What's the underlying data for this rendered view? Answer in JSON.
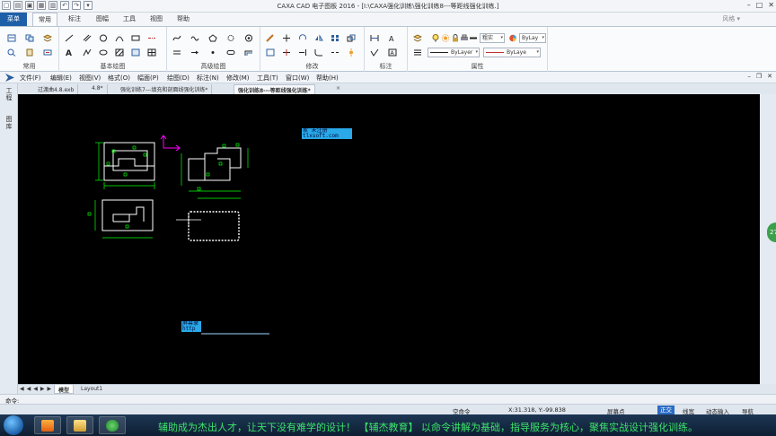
{
  "window": {
    "title": "CAXA CAD 电子图板 2016 - [I:\\CAXA强化训练\\强化训练8---等距线强化训练.]",
    "quick_access_icons": [
      "new-file-icon",
      "open-folder-icon",
      "save-icon",
      "save-as-icon",
      "print-icon",
      "undo-icon",
      "redo-icon",
      "dropdown-icon"
    ]
  },
  "ribbon_tabs": {
    "menu_button": "菜单",
    "tabs": [
      "常用",
      "标注",
      "图幅",
      "工具",
      "视图",
      "帮助"
    ],
    "active": "常用",
    "right_text": "风格 ▾"
  },
  "ribbon_groups": [
    {
      "label": "常用"
    },
    {
      "label": "基本绘图"
    },
    {
      "label": "高级绘图"
    },
    {
      "label": "修改"
    },
    {
      "label": "标注"
    },
    {
      "label": "属性"
    }
  ],
  "properties": {
    "line_width_label": "粗实",
    "layer_combo": "ByLay",
    "linetype_combo": "ByLayer",
    "color_combo": "ByLaye"
  },
  "menubar": {
    "items": [
      "文件(F)",
      "编辑(E)",
      "视图(V)",
      "格式(O)",
      "幅面(P)",
      "绘图(D)",
      "标注(N)",
      "修改(M)",
      "工具(T)",
      "窗口(W)",
      "帮助(H)"
    ]
  },
  "doc_tabs": {
    "tabs": [
      "过渡曲4.8.exb",
      "4.8*",
      "强化训练7---填充和剖面线强化训练*",
      "强化训练8---等距线强化训练*"
    ],
    "active_index": 3,
    "close_glyph": "×"
  },
  "left_panel": {
    "labels": [
      "工程",
      "图库"
    ]
  },
  "canvas": {
    "watermark1": {
      "line1": "家    未注册",
      "line2": "tlxsoft.com"
    },
    "watermark2": {
      "line1": "屏幕录",
      "line2": "http"
    },
    "badge": "27"
  },
  "layout_tabs": {
    "nav": "◀◀◀▶▶▶",
    "tabs": [
      "模型",
      "Layout1"
    ],
    "active": "模型"
  },
  "command_bar": {
    "prompt": "命令:"
  },
  "status_bar": {
    "command_state": "空命令",
    "coordinates": "X:31.318, Y:-99.838",
    "snap_mode": "屏幕点",
    "toggles": [
      {
        "label": "正交",
        "on": true
      },
      {
        "label": "线宽",
        "on": false
      },
      {
        "label": "动态输入",
        "on": false
      },
      {
        "label": "导航",
        "on": false
      }
    ]
  },
  "taskbar": {
    "slogan": "辅助成为杰出人才，让天下没有难学的设计！  【辅杰教育】  以命令讲解为基础，指导服务为核心，聚焦实战设计强化训练。",
    "app_icons": [
      "media-player-icon",
      "file-explorer-icon",
      "browser-icon"
    ]
  },
  "colors": {
    "canvas_bg": "#000000",
    "geometry": "#ffffff",
    "dimension": "#00ff00",
    "ucs_axis": "#ff00ff",
    "accent": "#2b6cc4",
    "slogan": "#3ce36a"
  }
}
